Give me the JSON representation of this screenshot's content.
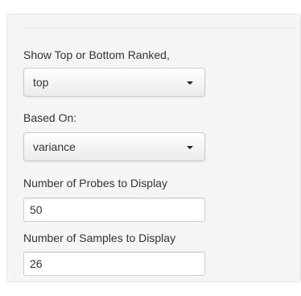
{
  "controls": {
    "rank_label": "Show Top or Bottom Ranked,",
    "rank_value": "top",
    "based_on_label": "Based On:",
    "based_on_value": "variance",
    "probes_label": "Number of Probes to Display",
    "probes_value": "50",
    "samples_label": "Number of Samples to Display",
    "samples_value": "26"
  },
  "icons": {
    "dropdown": "caret-down-icon"
  }
}
